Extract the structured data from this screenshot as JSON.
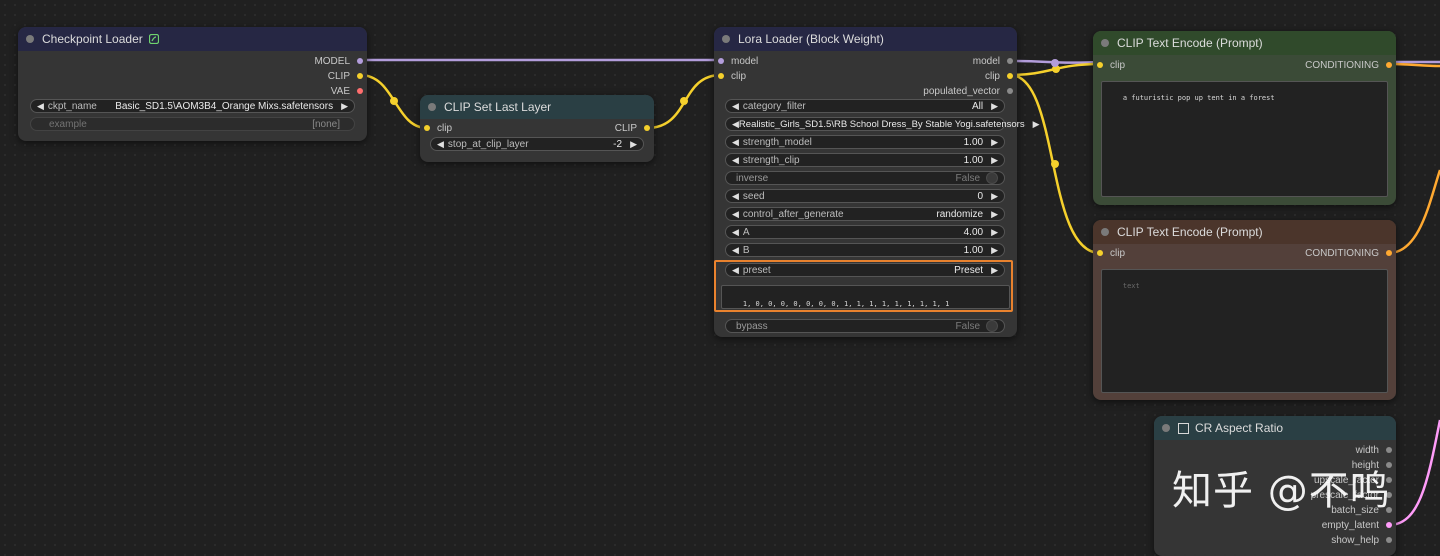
{
  "colors": {
    "canvas": "#202020",
    "node_body": "#353535",
    "title_navy": "#262744",
    "title_teal": "#2a3f44",
    "title_green": "#304a2b",
    "title_brown": "#4b352b",
    "wire_model": "#b39ddb",
    "wire_clip": "#f5d02c",
    "wire_cond": "#ffa931",
    "wire_latent": "#ff9cf9",
    "highlight": "#e9822e"
  },
  "checkpoint_loader": {
    "title": "Checkpoint Loader",
    "icon": "sprout-icon",
    "outputs": {
      "model": "MODEL",
      "clip": "CLIP",
      "vae": "VAE"
    },
    "ckpt_name": {
      "label": "ckpt_name",
      "value": "Basic_SD1.5\\AOM3B4_Orange Mixs.safetensors"
    },
    "example": {
      "label": "example",
      "value": "[none]"
    }
  },
  "clip_set_last_layer": {
    "title": "CLIP Set Last Layer",
    "input_clip": "clip",
    "output_clip": "CLIP",
    "stop_at_clip_layer": {
      "label": "stop_at_clip_layer",
      "value": "-2"
    }
  },
  "lora_loader": {
    "title": "Lora Loader (Block Weight)",
    "inputs": {
      "model": "model",
      "clip": "clip"
    },
    "outputs": {
      "model": "model",
      "clip": "clip",
      "populated_vector": "populated_vector"
    },
    "widgets": {
      "category_filter": {
        "label": "category_filter",
        "value": "All"
      },
      "lora_name": {
        "value": "Realistic_Girls_SD1.5\\RB School Dress_By Stable Yogi.safetensors"
      },
      "strength_model": {
        "label": "strength_model",
        "value": "1.00"
      },
      "strength_clip": {
        "label": "strength_clip",
        "value": "1.00"
      },
      "inverse": {
        "label": "inverse",
        "value": "False"
      },
      "seed": {
        "label": "seed",
        "value": "0"
      },
      "control_after_generate": {
        "label": "control_after_generate",
        "value": "randomize"
      },
      "A": {
        "label": "A",
        "value": "4.00"
      },
      "B": {
        "label": "B",
        "value": "1.00"
      },
      "preset": {
        "label": "preset",
        "value": "Preset"
      },
      "block_vector": "1, 0, 0, 0, 0, 0, 0, 0, 1, 1, 1, 1, 1, 1, 1, 1, 1",
      "bypass": {
        "label": "bypass",
        "value": "False"
      }
    }
  },
  "clip_text_encode_positive": {
    "title": "CLIP Text Encode (Prompt)",
    "input_clip": "clip",
    "output": "CONDITIONING",
    "text": "a futuristic pop up tent in a forest"
  },
  "clip_text_encode_negative": {
    "title": "CLIP Text Encode (Prompt)",
    "input_clip": "clip",
    "output": "CONDITIONING",
    "placeholder": "text"
  },
  "cr_aspect_ratio": {
    "title": "CR Aspect Ratio",
    "outputs": {
      "width": "width",
      "height": "height",
      "upscale_factor": "upscale_factor",
      "prescale_factor": "prescale_factor",
      "batch_size": "batch_size",
      "empty_latent": "empty_latent",
      "show_help": "show_help"
    }
  },
  "watermark": "知乎 @不鸣"
}
